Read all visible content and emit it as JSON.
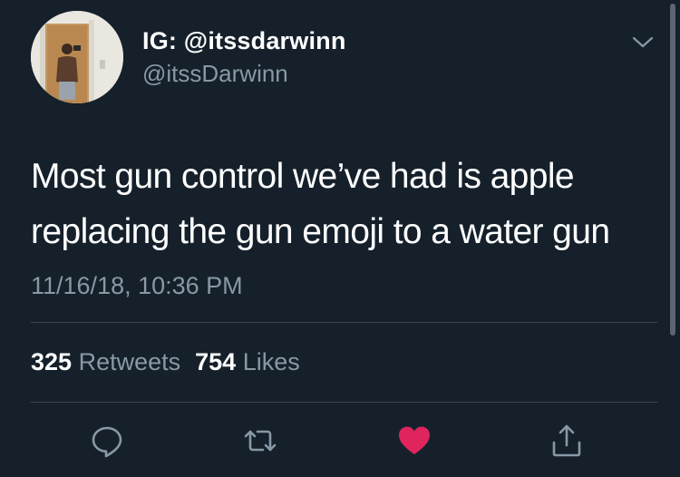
{
  "tweet": {
    "display_name": "IG: @itssdarwinn",
    "handle": "@itssDarwinn",
    "text": "Most gun control we’ve had is apple\nreplacing the gun emoji to a water gun",
    "timestamp": "11/16/18, 10:36 PM",
    "retweets_count": "325",
    "retweets_label": "Retweets",
    "likes_count": "754",
    "likes_label": "Likes",
    "liked": true
  },
  "icons": {
    "menu": "chevron-down-icon",
    "reply": "reply-icon",
    "retweet": "retweet-icon",
    "like": "heart-icon",
    "share": "share-icon"
  },
  "colors": {
    "background": "#15202b",
    "text": "#ffffff",
    "secondary_text": "#8899a6",
    "divider": "#38444d",
    "like_active": "#e0245e"
  }
}
